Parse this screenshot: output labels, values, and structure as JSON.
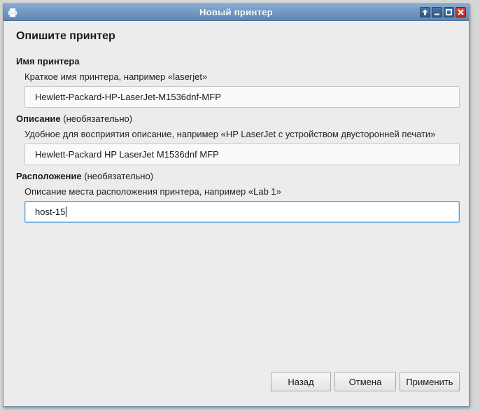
{
  "window": {
    "title": "Новый принтер"
  },
  "page": {
    "title": "Опишите принтер"
  },
  "name_section": {
    "label": "Имя принтера",
    "hint": "Краткое имя принтера, например «laserjet»",
    "value": "Hewlett-Packard-HP-LaserJet-M1536dnf-MFP"
  },
  "description_section": {
    "label": "Описание",
    "optional": "(необязательно)",
    "hint": "Удобное для восприятия описание, например «HP LaserJet с устройством двусторонней печати»",
    "value": "Hewlett-Packard HP LaserJet M1536dnf MFP"
  },
  "location_section": {
    "label": "Расположение",
    "optional": "(необязательно)",
    "hint": "Описание места расположения принтера, например «Lab 1»",
    "value": "host-15"
  },
  "buttons": {
    "back": "Назад",
    "cancel": "Отмена",
    "apply": "Применить"
  },
  "icons": {
    "app": "printer-icon",
    "window_controls": [
      "arrow-up-icon",
      "minimize-icon",
      "maximize-icon",
      "close-icon"
    ]
  },
  "colors": {
    "titlebar": "#6f93bd",
    "focus": "#5a9ed6",
    "close": "#c9342b"
  }
}
